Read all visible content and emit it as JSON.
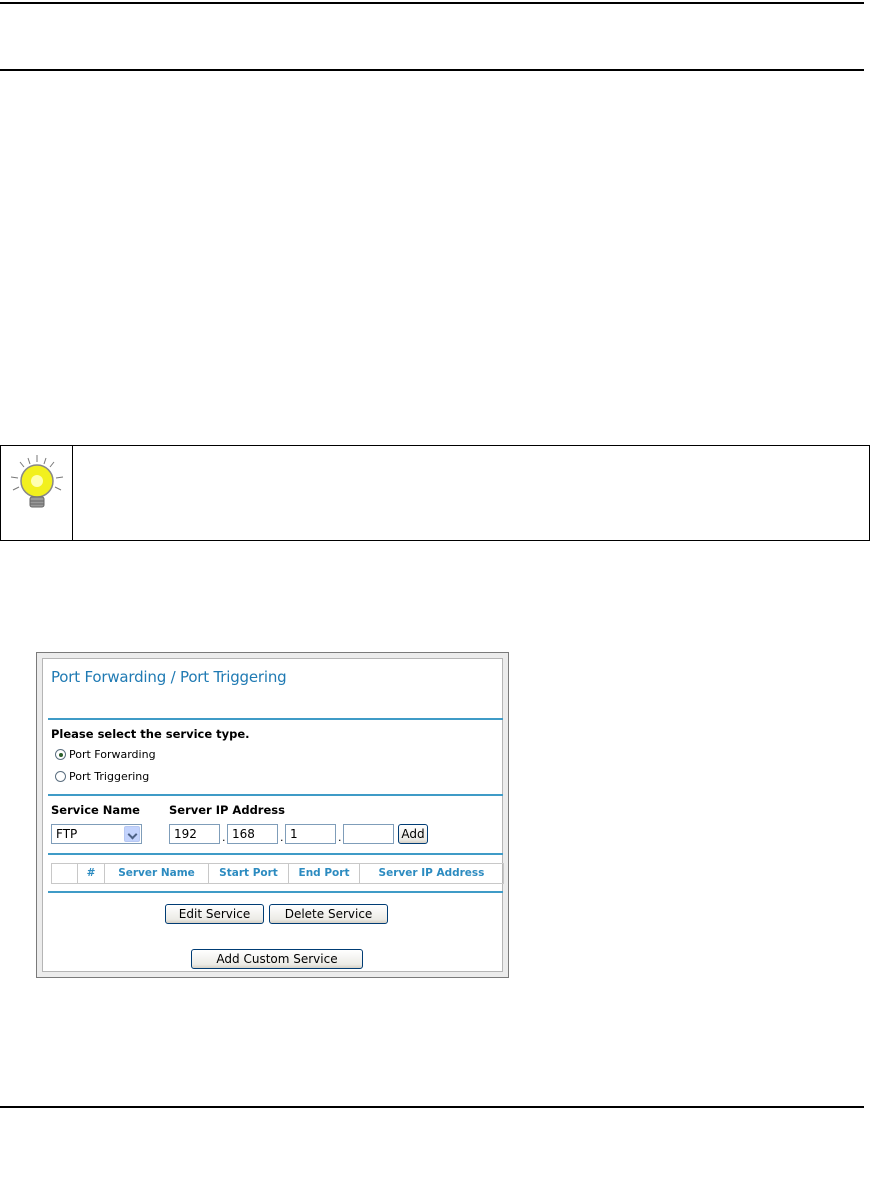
{
  "panel": {
    "title": "Port Forwarding / Port Triggering",
    "prompt": "Please select the service type.",
    "radio_options": [
      "Port Forwarding",
      "Port Triggering"
    ],
    "selected_option": "Port Forwarding",
    "service_name_label": "Service Name",
    "server_ip_label": "Server IP Address",
    "service_select_value": "FTP",
    "ip_octets": [
      "192",
      "168",
      "1",
      ""
    ],
    "add_label": "Add",
    "table_headers": [
      "",
      "#",
      "Server Name",
      "Start Port",
      "End Port",
      "Server IP Address"
    ],
    "edit_label": "Edit Service",
    "delete_label": "Delete Service",
    "add_custom_label": "Add Custom Service",
    "accent_color": "#1f7ab3"
  },
  "tip": {
    "icon": "lightbulb-icon"
  }
}
